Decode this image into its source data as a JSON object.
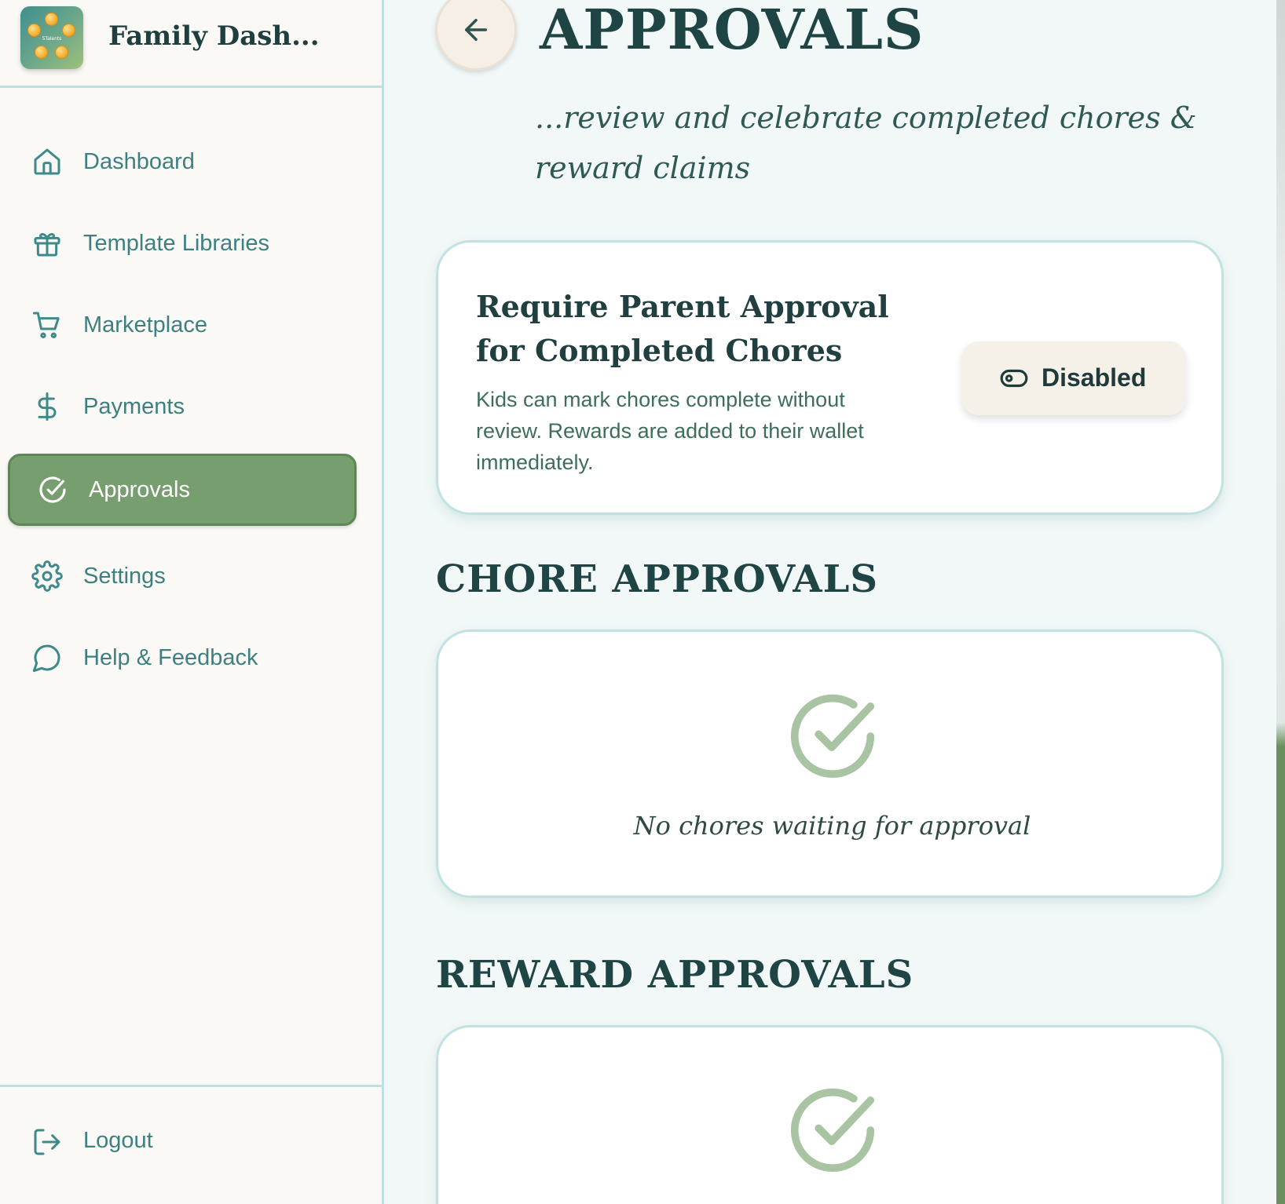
{
  "brand": {
    "title": "Family Dash...",
    "logo_text": "5Talents"
  },
  "sidebar": {
    "items": [
      {
        "label": "Dashboard",
        "icon": "home-icon"
      },
      {
        "label": "Template Libraries",
        "icon": "gift-icon"
      },
      {
        "label": "Marketplace",
        "icon": "cart-icon"
      },
      {
        "label": "Payments",
        "icon": "dollar-icon"
      },
      {
        "label": "Approvals",
        "icon": "check-circle-icon",
        "active": true
      },
      {
        "label": "Settings",
        "icon": "gear-icon"
      },
      {
        "label": "Help & Feedback",
        "icon": "chat-bubble-icon"
      }
    ],
    "logout_label": "Logout"
  },
  "page": {
    "title": "APPROVALS",
    "subtitle": "...review and celebrate completed chores & reward claims"
  },
  "setting": {
    "title": "Require Parent Approval for Completed Chores",
    "description": "Kids can mark chores complete without review. Rewards are added to their wallet immediately.",
    "toggle_label": "Disabled",
    "toggle_icon": "toggle-off-icon"
  },
  "chore_approvals": {
    "heading": "CHORE APPROVALS",
    "empty_text": "No chores waiting for approval"
  },
  "reward_approvals": {
    "heading": "REWARD APPROVALS"
  },
  "colors": {
    "accent_green": "#779e6f",
    "teal_text": "#3e7f80",
    "border_teal": "#c1e2e2",
    "heading_dark": "#1f4444",
    "check_light": "#a9c4a3"
  }
}
